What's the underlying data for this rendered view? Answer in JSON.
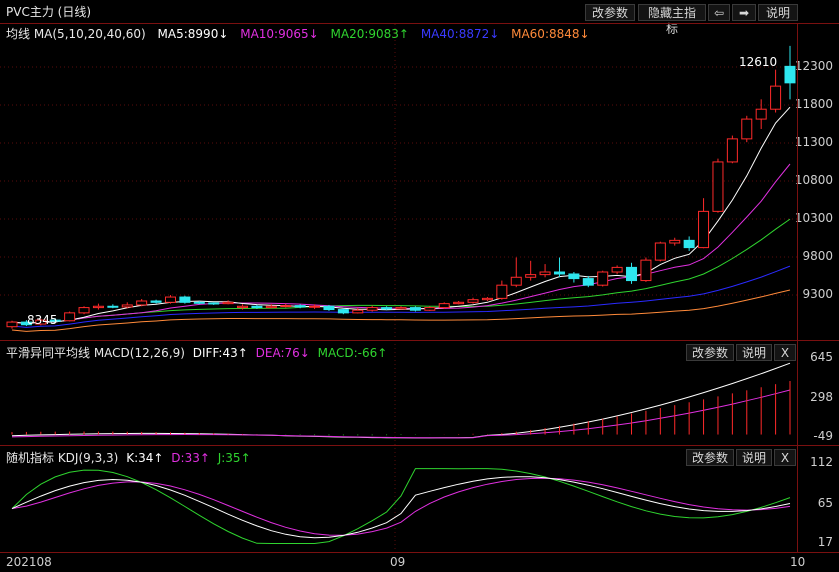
{
  "header": {
    "title": "PVC主力 (日线)",
    "btn_params": "改参数",
    "btn_hide": "隐藏主指标",
    "btn_left": "⇦",
    "btn_right": "➡",
    "btn_help": "说明"
  },
  "main_legend": {
    "name": "均线 MA(5,10,20,40,60)",
    "ma5": "MA5:8990↓",
    "ma10": "MA10:9065↓",
    "ma20": "MA20:9083↑",
    "ma40": "MA40:8872↓",
    "ma60": "MA60:8848↓"
  },
  "main_labels": {
    "high": "12610",
    "low": "8345"
  },
  "main_yticks": [
    "12300",
    "11800",
    "11300",
    "10800",
    "10300",
    "9800",
    "9300"
  ],
  "macd_header": {
    "legend_name": "平滑异同平均线 MACD(12,26,9)",
    "diff": "DIFF:43↑",
    "dea": "DEA:76↓",
    "macd": "MACD:-66↑",
    "btn_params": "改参数",
    "btn_help": "说明",
    "btn_close": "X"
  },
  "macd_yticks": [
    "645",
    "298",
    "-49"
  ],
  "kdj_header": {
    "legend_name": "随机指标 KDJ(9,3,3)",
    "k": "K:34↑",
    "d": "D:33↑",
    "j": "J:35↑",
    "btn_params": "改参数",
    "btn_help": "说明",
    "btn_close": "X"
  },
  "kdj_yticks": [
    "112",
    "65",
    "17"
  ],
  "x_labels": [
    "202108",
    "09",
    "10"
  ],
  "colors": {
    "up": "#ff2a2a",
    "down": "#2ee6ee",
    "ma5": "#ffffff",
    "ma10": "#e030e0",
    "ma20": "#2fd42f",
    "ma40": "#2a2aff",
    "ma60": "#ff8a3a",
    "grid": "#7a1010"
  },
  "chart_data": {
    "type": "candlestick",
    "ylim": [
      8300,
      12700
    ],
    "candles": [
      [
        8350,
        8420,
        8320,
        8440
      ],
      [
        8420,
        8380,
        8360,
        8450
      ],
      [
        8390,
        8450,
        8370,
        8470
      ],
      [
        8450,
        8440,
        8420,
        8480
      ],
      [
        8440,
        8560,
        8430,
        8580
      ],
      [
        8560,
        8640,
        8540,
        8660
      ],
      [
        8640,
        8660,
        8610,
        8700
      ],
      [
        8660,
        8650,
        8630,
        8690
      ],
      [
        8650,
        8680,
        8630,
        8720
      ],
      [
        8680,
        8740,
        8660,
        8770
      ],
      [
        8740,
        8720,
        8700,
        8760
      ],
      [
        8720,
        8800,
        8700,
        8830
      ],
      [
        8800,
        8720,
        8700,
        8820
      ],
      [
        8720,
        8710,
        8690,
        8740
      ],
      [
        8710,
        8700,
        8680,
        8720
      ],
      [
        8700,
        8720,
        8690,
        8750
      ],
      [
        8640,
        8660,
        8610,
        8690
      ],
      [
        8660,
        8640,
        8620,
        8680
      ],
      [
        8640,
        8660,
        8630,
        8690
      ],
      [
        8660,
        8670,
        8640,
        8700
      ],
      [
        8670,
        8650,
        8630,
        8690
      ],
      [
        8650,
        8660,
        8620,
        8690
      ],
      [
        8660,
        8610,
        8590,
        8680
      ],
      [
        8610,
        8560,
        8540,
        8630
      ],
      [
        8560,
        8600,
        8550,
        8640
      ],
      [
        8600,
        8640,
        8580,
        8670
      ],
      [
        8640,
        8620,
        8600,
        8660
      ],
      [
        8620,
        8640,
        8610,
        8660
      ],
      [
        8640,
        8600,
        8580,
        8660
      ],
      [
        8600,
        8640,
        8590,
        8660
      ],
      [
        8640,
        8700,
        8620,
        8720
      ],
      [
        8700,
        8720,
        8690,
        8740
      ],
      [
        8720,
        8760,
        8700,
        8790
      ],
      [
        8760,
        8780,
        8740,
        8800
      ],
      [
        8780,
        8980,
        8760,
        9050
      ],
      [
        8980,
        9100,
        8950,
        9400
      ],
      [
        9100,
        9140,
        9050,
        9350
      ],
      [
        9140,
        9180,
        9100,
        9300
      ],
      [
        9180,
        9150,
        9100,
        9400
      ],
      [
        9150,
        9080,
        9020,
        9180
      ],
      [
        9080,
        8980,
        8950,
        9120
      ],
      [
        8980,
        9180,
        8960,
        9200
      ],
      [
        9180,
        9250,
        9150,
        9280
      ],
      [
        9250,
        9050,
        9000,
        9320
      ],
      [
        9050,
        9360,
        9030,
        9400
      ],
      [
        9360,
        9620,
        9340,
        9640
      ],
      [
        9620,
        9660,
        9580,
        9700
      ],
      [
        9660,
        9550,
        9500,
        9720
      ],
      [
        9550,
        10100,
        9540,
        10300
      ],
      [
        10100,
        10850,
        10080,
        10900
      ],
      [
        10850,
        11200,
        10830,
        11250
      ],
      [
        11200,
        11500,
        11150,
        11550
      ],
      [
        11500,
        11650,
        11350,
        11800
      ],
      [
        11650,
        12000,
        11600,
        12250
      ],
      [
        12300,
        12050,
        11800,
        12610
      ]
    ]
  }
}
